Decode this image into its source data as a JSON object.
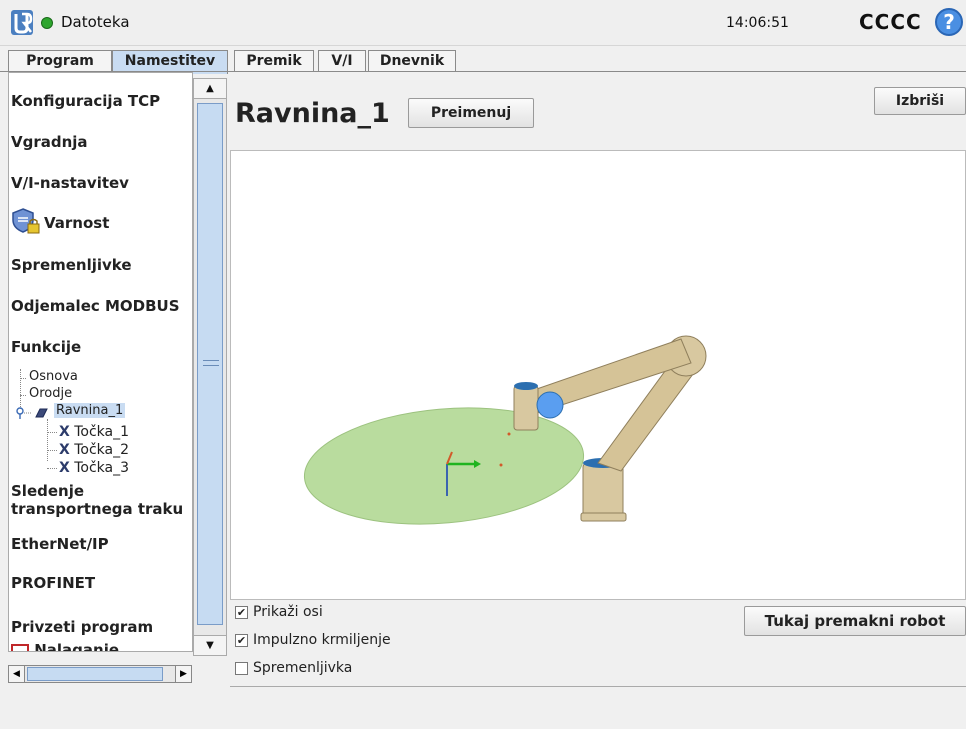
{
  "header": {
    "file_menu": "Datoteka",
    "clock": "14:06:51",
    "robot_name": "CCCC",
    "help_glyph": "?"
  },
  "tabs": [
    {
      "label": "Program",
      "active": false
    },
    {
      "label": "Namestitev",
      "active": true
    },
    {
      "label": "Premik",
      "active": false
    },
    {
      "label": "V/I",
      "active": false
    },
    {
      "label": "Dnevnik",
      "active": false
    }
  ],
  "sidebar": {
    "items": [
      {
        "label": "Konfiguracija TCP"
      },
      {
        "label": "Vgradnja"
      },
      {
        "label": "V/I-nastavitev"
      },
      {
        "label": "Varnost",
        "icon": "safety-shield-lock-icon"
      },
      {
        "label": "Spremenljivke"
      },
      {
        "label": "Odjemalec MODBUS"
      },
      {
        "label": "Funkcije"
      },
      {
        "label": "Sledenje"
      },
      {
        "label": "transportnega traku"
      },
      {
        "label": "EtherNet/IP"
      },
      {
        "label": "PROFINET"
      },
      {
        "label": "Privzeti program"
      },
      {
        "label": "Nalaganje"
      }
    ],
    "features_tree": {
      "base": "Osnova",
      "tool": "Orodje",
      "plane": {
        "label": "Ravnina_1",
        "selected": true
      },
      "points": [
        "Točka_1",
        "Točka_2",
        "Točka_3"
      ]
    }
  },
  "main": {
    "title": "Ravnina_1",
    "rename_button": "Preimenuj",
    "delete_button": "Izbriši",
    "move_button": "Tukaj premakni robot",
    "checkboxes": [
      {
        "label": "Prikaži osi",
        "checked": true
      },
      {
        "label": "Impulzno krmiljenje",
        "checked": true
      },
      {
        "label": "Spremenljivka",
        "checked": false
      }
    ]
  },
  "colors": {
    "accent": "#c9dcf2",
    "plane_fill": "#b9dc9e",
    "robot_body": "#d8c8a0",
    "robot_joint_blue": "#2c6fb0",
    "status_green": "#2ea52e",
    "help_blue": "#4a8fe2"
  }
}
